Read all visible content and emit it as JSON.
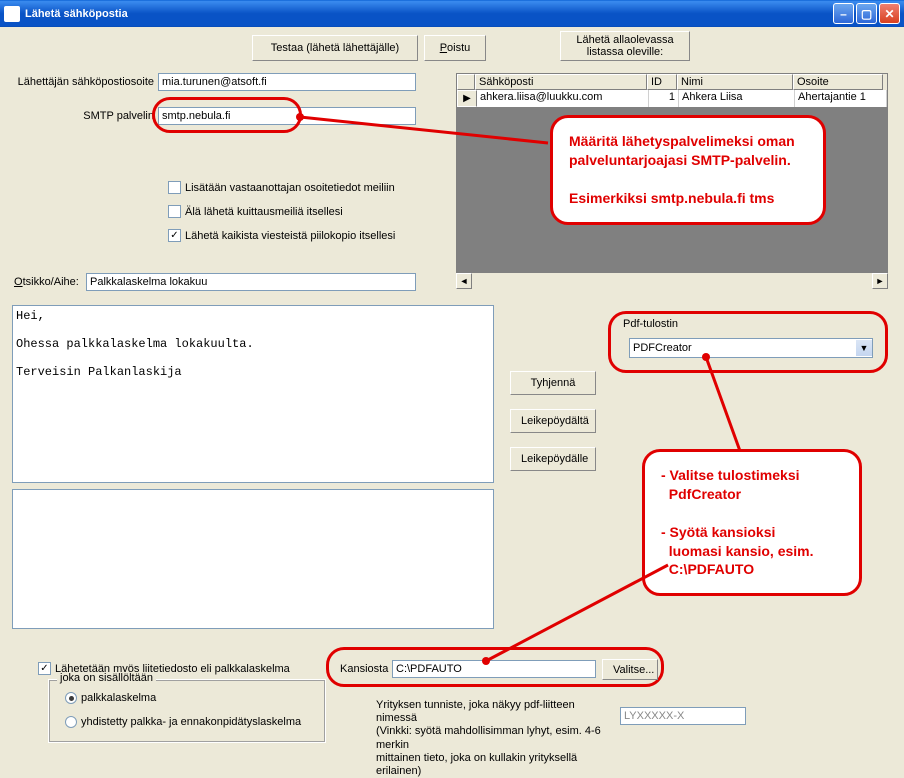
{
  "window": {
    "title": "Lähetä sähköpostia"
  },
  "top": {
    "test_btn": "Testaa (lähetä lähettäjälle)",
    "exit_btn_u": "P",
    "exit_btn_rest": "oistu",
    "send_btn_l1": "Lähetä allaolevassa",
    "send_btn_l2": "listassa oleville:"
  },
  "sender": {
    "label": "Lähettäjän sähköpostiosoite",
    "value": "mia.turunen@atsoft.fi"
  },
  "smtp": {
    "label": "SMTP palvelin",
    "value": "smtp.nebula.fi"
  },
  "options": {
    "add_addr": "Lisätään vastaanottajan osoitetiedot meiliin",
    "no_ack": "Älä lähetä kuittausmeiliä itsellesi",
    "bcc": "Lähetä kaikista viesteistä piilokopio itsellesi"
  },
  "subject": {
    "label_u": "O",
    "label_rest": "tsikko/Aihe:",
    "value": "Palkkalaskelma lokakuu"
  },
  "body": "Hei,\n\nOhessa palkkalaskelma lokakuulta.\n\nTerveisin Palkanlaskija",
  "grid": {
    "headers": [
      "",
      "Sähköposti",
      "ID",
      "Nimi",
      "Osoite"
    ],
    "row": {
      "email": "ahkera.liisa@luukku.com",
      "id": "1",
      "name": "Ahkera Liisa",
      "addr": "Ahertajantie 1"
    }
  },
  "mid_btns": {
    "clear": "Tyhjennä",
    "from_clip": "Leikepöydältä",
    "to_clip": "Leikepöydälle"
  },
  "pdf": {
    "group": "Pdf-tulostin",
    "value": "PDFCreator"
  },
  "attach": {
    "check": "Lähetetään myös liitetiedosto eli palkkalaskelma",
    "folder_lbl": "Kansiosta",
    "folder_val": "C:\\PDFAUTO",
    "browse": "Valitse...",
    "group": "joka on sisällöltään",
    "r1": "palkkalaskelma",
    "r2": "yhdistetty palkka- ja ennakonpidätyslaskelma"
  },
  "hint": {
    "l1": "Yrityksen tunniste, joka näkyy pdf-liitteen nimessä",
    "l2": "(Vinkki: syötä mahdollisimman lyhyt, esim. 4-6 merkin",
    "l3": "mittainen tieto, joka on kullakin yrityksellä erilainen)",
    "value": "LYXXXXX-X"
  },
  "callout1": "Määritä lähetyspalvelimeksi oman palveluntarjoajasi SMTP-palvelin.\n\nEsimerkiksi smtp.nebula.fi tms",
  "callout2": "- Valitse tulostimeksi\n  PdfCreator\n\n- Syötä kansioksi\n  luomasi kansio, esim.\n  C:\\PDFAUTO"
}
